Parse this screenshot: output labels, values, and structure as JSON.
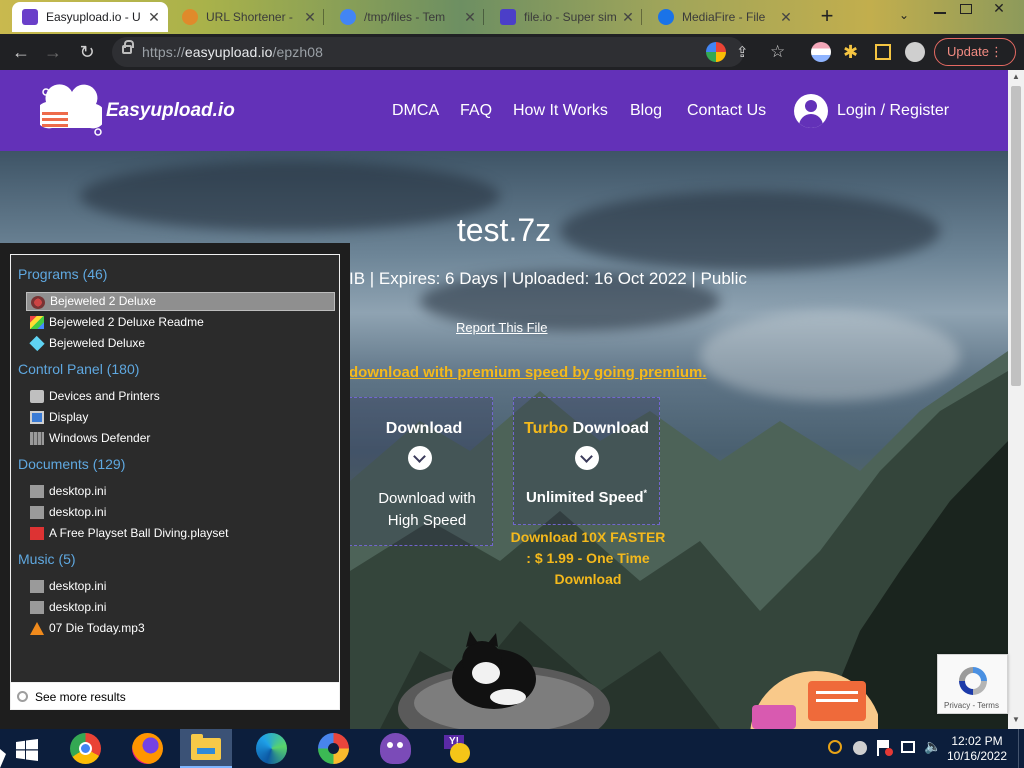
{
  "browser": {
    "tabs": [
      {
        "title": "Easyupload.io - U",
        "active": true,
        "color": "#6a3fc9"
      },
      {
        "title": "URL Shortener - ",
        "active": false,
        "color": "#e08a2b"
      },
      {
        "title": "/tmp/files - Tem",
        "active": false,
        "color": "#4285f4"
      },
      {
        "title": "file.io - Super sim",
        "active": false,
        "color": "#4b3fc8"
      },
      {
        "title": "MediaFire - File",
        "active": false,
        "color": "#1a73e8"
      }
    ],
    "new_tab_label": "+",
    "url_scheme": "https://",
    "url_host": "easyupload.io",
    "url_path": "/epzh08",
    "update_label": "Update"
  },
  "site": {
    "logo_text": "Easyupload.io",
    "nav": [
      "DMCA",
      "FAQ",
      "How It Works",
      "Blog",
      "Contact Us"
    ],
    "login_label": "Login / Register",
    "brand_color": "#6331b8"
  },
  "file": {
    "name": "test.7z",
    "meta": "IB | Expires: 6 Days | Uploaded: 16 Oct 2022 | Public",
    "report_label": "Report This File",
    "premium_text": "download with premium speed by going premium.",
    "download_title": "Download",
    "download_sub1": "Download with",
    "download_sub2": "High Speed",
    "turbo_word": "Turbo",
    "turbo_title": "Download",
    "turbo_sub": "Unlimited Speed",
    "turbo_mark": "*",
    "turbo_price": [
      "Download 10X FASTER",
      ": $ 1.99 - One Time",
      "Download"
    ],
    "accent": "#f4b91c"
  },
  "start_menu": {
    "groups": [
      {
        "label": "Programs (46)",
        "items": [
          {
            "label": "Bejeweled 2 Deluxe",
            "icon": "bejeweled-2-icon",
            "selected": true
          },
          {
            "label": "Bejeweled 2 Deluxe Readme",
            "icon": "readme-icon",
            "selected": false
          },
          {
            "label": "Bejeweled Deluxe",
            "icon": "gem-icon",
            "selected": false
          }
        ]
      },
      {
        "label": "Control Panel (180)",
        "items": [
          {
            "label": "Devices and Printers",
            "icon": "printer-icon",
            "selected": false
          },
          {
            "label": "Display",
            "icon": "monitor-icon",
            "selected": false
          },
          {
            "label": "Windows Defender",
            "icon": "castle-wall-icon",
            "selected": false
          }
        ]
      },
      {
        "label": "Documents (129)",
        "items": [
          {
            "label": "desktop.ini",
            "icon": "settings-file-icon",
            "selected": false
          },
          {
            "label": "desktop.ini",
            "icon": "settings-file-icon",
            "selected": false
          },
          {
            "label": "A Free Playset Ball Diving.playset",
            "icon": "playset-file-icon",
            "selected": false
          }
        ]
      },
      {
        "label": "Music (5)",
        "items": [
          {
            "label": "desktop.ini",
            "icon": "settings-file-icon",
            "selected": false
          },
          {
            "label": "desktop.ini",
            "icon": "settings-file-icon",
            "selected": false
          },
          {
            "label": "07 Die Today.mp3",
            "icon": "vlc-cone-icon",
            "selected": false
          }
        ]
      }
    ],
    "see_more": "See more results"
  },
  "recaptcha": {
    "links": "Privacy - Terms"
  },
  "taskbar": {
    "apps": [
      "chrome-icon",
      "firefox-icon",
      "file-explorer-icon",
      "edge-icon",
      "picasa-icon",
      "bonzi-buddy-icon",
      "yahoo-messenger-icon"
    ],
    "time": "12:02 PM",
    "date": "10/16/2022"
  }
}
